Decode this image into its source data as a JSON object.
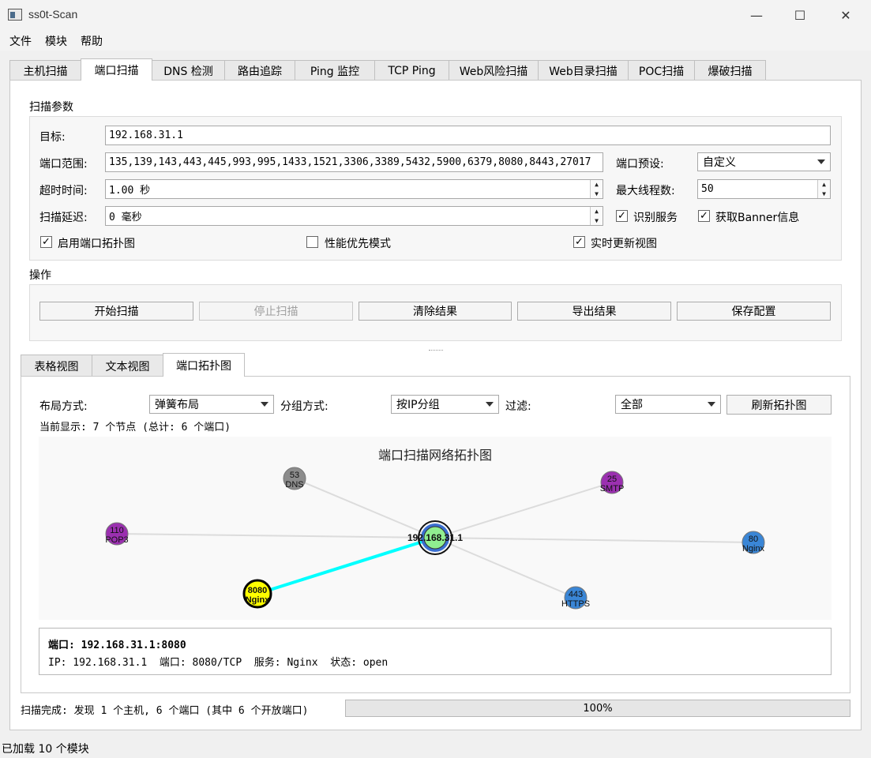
{
  "window": {
    "title": "ss0t-Scan",
    "min_glyph": "—",
    "max_glyph": "☐",
    "close_glyph": "✕"
  },
  "menu": [
    "文件",
    "模块",
    "帮助"
  ],
  "tabs": [
    "主机扫描",
    "端口扫描",
    "DNS 检测",
    "路由追踪",
    "Ping 监控",
    "TCP Ping",
    "Web风险扫描",
    "Web目录扫描",
    "POC扫描",
    "爆破扫描"
  ],
  "scan_params": {
    "group_title": "扫描参数",
    "target_label": "目标:",
    "target_value": "192.168.31.1",
    "port_range_label": "端口范围:",
    "port_range_value": "135,139,143,443,445,993,995,1433,1521,3306,3389,5432,5900,6379,8080,8443,27017",
    "port_preset_label": "端口预设:",
    "port_preset_value": "自定义",
    "timeout_label": "超时时间:",
    "timeout_value": "1.00 秒",
    "max_threads_label": "最大线程数:",
    "max_threads_value": "50",
    "delay_label": "扫描延迟:",
    "delay_value": "0 毫秒",
    "identify_service_label": "识别服务",
    "identify_service_checked": true,
    "banner_label": "获取Banner信息",
    "banner_checked": true,
    "enable_topology_label": "启用端口拓扑图",
    "enable_topology_checked": true,
    "perf_mode_label": "性能优先模式",
    "perf_mode_checked": false,
    "realtime_label": "实时更新视图",
    "realtime_checked": true
  },
  "actions": {
    "group_title": "操作",
    "start": "开始扫描",
    "stop": "停止扫描",
    "clear": "清除结果",
    "export": "导出结果",
    "save": "保存配置"
  },
  "view_tabs": [
    "表格视图",
    "文本视图",
    "端口拓扑图"
  ],
  "topology": {
    "layout_label": "布局方式:",
    "layout_value": "弹簧布局",
    "group_label": "分组方式:",
    "group_value": "按IP分组",
    "filter_label": "过滤:",
    "filter_value": "全部",
    "refresh": "刷新拓扑图",
    "summary": "当前显示: 7 个节点 (总计: 6 个端口)",
    "graph_title": "端口扫描网络拓扑图",
    "center_node": {
      "label": "192.168.31.1",
      "color": "#90ee90"
    },
    "nodes": [
      {
        "port": "53",
        "service": "DNS",
        "color": "#8c8c8c"
      },
      {
        "port": "25",
        "service": "SMTP",
        "color": "#9b30b0"
      },
      {
        "port": "110",
        "service": "POP3",
        "color": "#9b30b0"
      },
      {
        "port": "80",
        "service": "Nginx",
        "color": "#3a86d6"
      },
      {
        "port": "8080",
        "service": "Nginx",
        "color": "#ffff00",
        "selected": true
      },
      {
        "port": "443",
        "service": "HTTPS",
        "color": "#3a86d6"
      }
    ],
    "highlight_edge_color": "#00ffff",
    "edge_color": "#dcdcdc"
  },
  "info": {
    "title": "端口: 192.168.31.1:8080",
    "details": "IP: 192.168.31.1  端口: 8080/TCP  服务: Nginx  状态: open"
  },
  "status": {
    "scan_result": "扫描完成: 发现 1 个主机, 6 个端口 (其中 6 个开放端口)",
    "progress_text": "100%",
    "progress_value": 100,
    "bottom": "已加载 10 个模块"
  }
}
